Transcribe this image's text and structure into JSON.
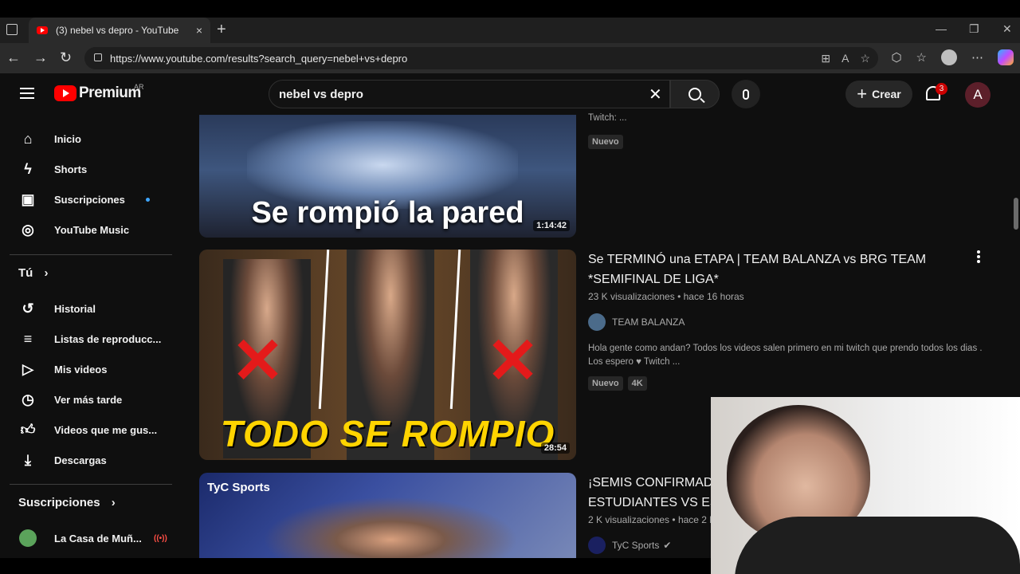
{
  "browser": {
    "tab_title": "(3) nebel vs depro - YouTube",
    "tab_close": "×",
    "new_tab": "+",
    "url": "https://www.youtube.com/results?search_query=nebel+vs+depro"
  },
  "header": {
    "logo_text": "Premium",
    "region": "AR",
    "search_value": "nebel vs depro",
    "create_label": "Crear",
    "notification_count": "3",
    "account_initial": "A"
  },
  "sidebar": {
    "items": [
      {
        "label": "Inicio",
        "icon": "home-icon"
      },
      {
        "label": "Shorts",
        "icon": "shorts-icon"
      },
      {
        "label": "Suscripciones",
        "icon": "subscriptions-icon"
      },
      {
        "label": "YouTube Music",
        "icon": "music-icon"
      }
    ],
    "you_heading": "Tú",
    "you_items": [
      {
        "label": "Historial",
        "icon": "history-icon"
      },
      {
        "label": "Listas de reproducc...",
        "icon": "playlists-icon"
      },
      {
        "label": "Mis videos",
        "icon": "my-videos-icon"
      },
      {
        "label": "Ver más tarde",
        "icon": "watch-later-icon"
      },
      {
        "label": "Videos que me gus...",
        "icon": "liked-icon"
      },
      {
        "label": "Descargas",
        "icon": "download-icon"
      }
    ],
    "subs_heading": "Suscripciones",
    "subs_items": [
      {
        "label": "La Casa de Muñ..."
      }
    ]
  },
  "results": [
    {
      "thumb_text": "Se rompió la pared",
      "duration": "1:14:42",
      "desc_tail": "Twitch: ...",
      "tags": [
        "Nuevo"
      ]
    },
    {
      "title": "Se TERMINÓ una ETAPA | TEAM BALANZA vs BRG TEAM *SEMIFINAL DE LIGA*",
      "views": "23 K visualizaciones",
      "age": "hace 16 horas",
      "channel": "TEAM BALANZA",
      "description": "Hola gente como andan? Todos los videos salen primero en mi twitch que prendo todos los dias . Los espero ♥ Twitch ...",
      "thumb_text": "TODO SE ROMPIO",
      "duration": "28:54",
      "tags": [
        "Nuevo",
        "4K"
      ]
    },
    {
      "title": "¡SEMIS CONFIRMAD... ESTUDIANTES VS ES...",
      "title_line1": "¡SEMIS CONFIRMAD",
      "title_line2": "ESTUDIANTES VS ES",
      "views": "2 K visualizaciones",
      "age": "hace 2 h",
      "channel": "TyC Sports",
      "thumb_text": "TyC Sports"
    }
  ]
}
